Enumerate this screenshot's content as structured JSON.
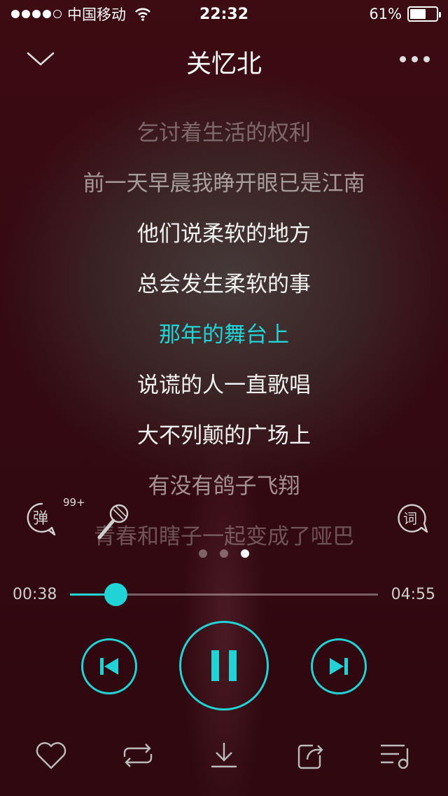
{
  "status_bar": {
    "carrier": "中国移动",
    "time": "22:32",
    "battery_percent_label": "61%",
    "battery_level": 0.61,
    "signal_bars": 4,
    "signal_total": 5
  },
  "header": {
    "title": "关忆北",
    "back_icon": "chevron-down-icon",
    "more_icon": "more-dots-icon"
  },
  "lyrics": [
    {
      "text": "乞讨着生活的权利",
      "state": "faded1"
    },
    {
      "text": "前一天早晨我睁开眼已是江南",
      "state": "faded2"
    },
    {
      "text": "他们说柔软的地方",
      "state": "normal"
    },
    {
      "text": "总会发生柔软的事",
      "state": "normal"
    },
    {
      "text": "那年的舞台上",
      "state": "active"
    },
    {
      "text": "说谎的人一直歌唱",
      "state": "normal"
    },
    {
      "text": "大不列颠的广场上",
      "state": "normal"
    },
    {
      "text": "有没有鸽子飞翔",
      "state": "faded2"
    },
    {
      "text": "青春和瞎子一起变成了哑巴",
      "state": "faded3"
    }
  ],
  "mid_icons": {
    "danmu_label": "弹",
    "danmu_badge": "99+",
    "lyric_label": "词"
  },
  "pager": {
    "count": 3,
    "active_index": 2
  },
  "progress": {
    "current": "00:38",
    "total": "04:55",
    "fraction": 0.148
  },
  "colors": {
    "accent": "#22d3d6",
    "background": "#3a0a10"
  },
  "bottom_bar": [
    "heart-icon",
    "repeat-icon",
    "download-icon",
    "share-icon",
    "playlist-icon"
  ]
}
